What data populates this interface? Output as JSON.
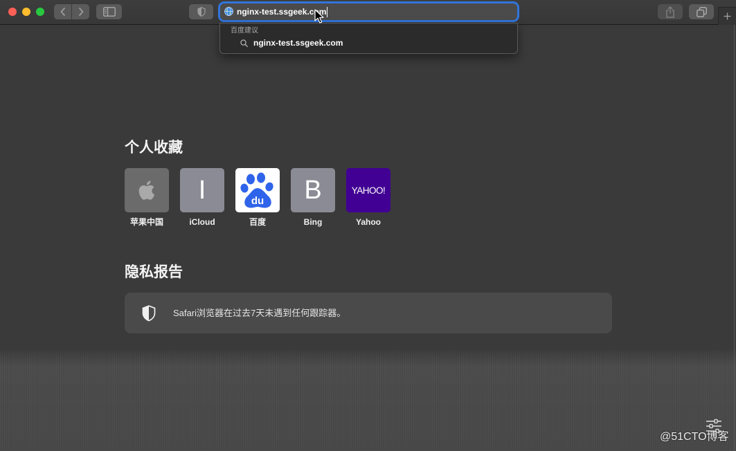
{
  "theme": {
    "accent_color": "#3275dc",
    "page_background": "#3a3a3a"
  },
  "window": {
    "controls": [
      {
        "name": "close",
        "color": "#ff5f57"
      },
      {
        "name": "minimize",
        "color": "#febc2e"
      },
      {
        "name": "zoom",
        "color": "#28c840"
      }
    ]
  },
  "toolbar": {
    "back_icon": "chevron-left-icon",
    "forward_icon": "chevron-right-icon",
    "sidebar_icon": "sidebar-icon",
    "privacy_icon": "shield-icon",
    "address": {
      "site_icon": "globe-icon",
      "value": "nginx-test.ssgeek.com"
    },
    "share_icon": "share-icon",
    "tab_overview_icon": "tab-overview-icon",
    "new_tab_icon": "plus-icon"
  },
  "suggestions": {
    "section_label": "百度建议",
    "items": [
      {
        "icon": "search-icon",
        "text": "nginx-test.ssgeek.com"
      }
    ]
  },
  "favorites": {
    "heading": "个人收藏",
    "items": [
      {
        "label": "苹果中国",
        "icon": "apple-logo-icon",
        "color": "#6b6b6b"
      },
      {
        "label": "iCloud",
        "tile_text": "I",
        "color": "#8b8b95"
      },
      {
        "label": "百度",
        "icon": "baidu-paw-icon",
        "tile_text": "du",
        "color": "#ffffff"
      },
      {
        "label": "Bing",
        "tile_text": "B",
        "color": "#8b8b95"
      },
      {
        "label": "Yahoo",
        "tile_text": "YAHOO!",
        "color": "#410093"
      }
    ]
  },
  "privacy_report": {
    "heading": "隐私报告",
    "icon": "shield-icon",
    "message": "Safari浏览器在过去7天未遇到任何跟踪器。"
  },
  "customize_icon": "sliders-icon",
  "cursor_icon": "arrow-cursor-icon",
  "watermark": "@51CTO博客"
}
